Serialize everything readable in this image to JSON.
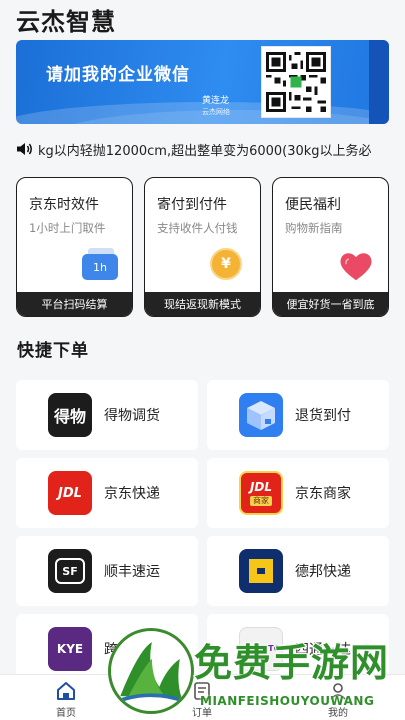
{
  "header": {
    "title": "云杰智慧"
  },
  "banner": {
    "headline": "请加我的企业微信",
    "contact_name": "黄连龙",
    "contact_company": "云杰网络",
    "qr_icon": "qr-code-icon"
  },
  "notice": {
    "icon": "speaker-icon",
    "text": "kg以内轻抛12000cm,超出整单变为6000(30kg以上务必"
  },
  "service_cards": [
    {
      "title": "京东时效件",
      "desc": "1小时上门取件",
      "badge": "1h",
      "footer": "平台扫码结算"
    },
    {
      "title": "寄付到付件",
      "desc": "支持收件人付钱",
      "badge": "¥",
      "footer": "现结返现新模式"
    },
    {
      "title": "便民福利",
      "desc": "购物新指南",
      "footer": "便宜好货一省到底"
    }
  ],
  "quick_order": {
    "title": "快捷下单",
    "items": [
      {
        "label": "得物调货",
        "logo_text": "得物",
        "logo_bg": "#1c1c1c"
      },
      {
        "label": "退货到付",
        "logo_text": "",
        "logo_bg": "#2f7ff0"
      },
      {
        "label": "京东快递",
        "logo_text": "JDL",
        "logo_bg": "#e2231a"
      },
      {
        "label": "京东商家",
        "logo_text": "JDL",
        "logo_sub": "商家",
        "logo_bg": "#e2231a"
      },
      {
        "label": "顺丰速运",
        "logo_text": "SF",
        "logo_bg": "#1c1c1c"
      },
      {
        "label": "德邦快递",
        "logo_text": "",
        "logo_bg": "#0f2e6e"
      },
      {
        "label": "跨越速运",
        "logo_text": "KYE",
        "logo_bg": "#5a2a82"
      },
      {
        "label": "四通一达",
        "logo_text": "YTO ZTO",
        "logo_bg": "#f2f2f2"
      }
    ]
  },
  "tabbar": {
    "tabs": [
      {
        "label": "首页",
        "icon": "home-icon"
      },
      {
        "label": "订单",
        "icon": "order-icon"
      },
      {
        "label": "我的",
        "icon": "profile-icon"
      }
    ]
  },
  "watermark": {
    "title": "免费手游网",
    "subtitle": "MIANFEISHOUYOUWANG"
  },
  "colors": {
    "accent": "#2f8cf0",
    "card_border": "#1e1e1e",
    "card_footer": "#232323",
    "watermark_green": "#2f8f2a"
  }
}
